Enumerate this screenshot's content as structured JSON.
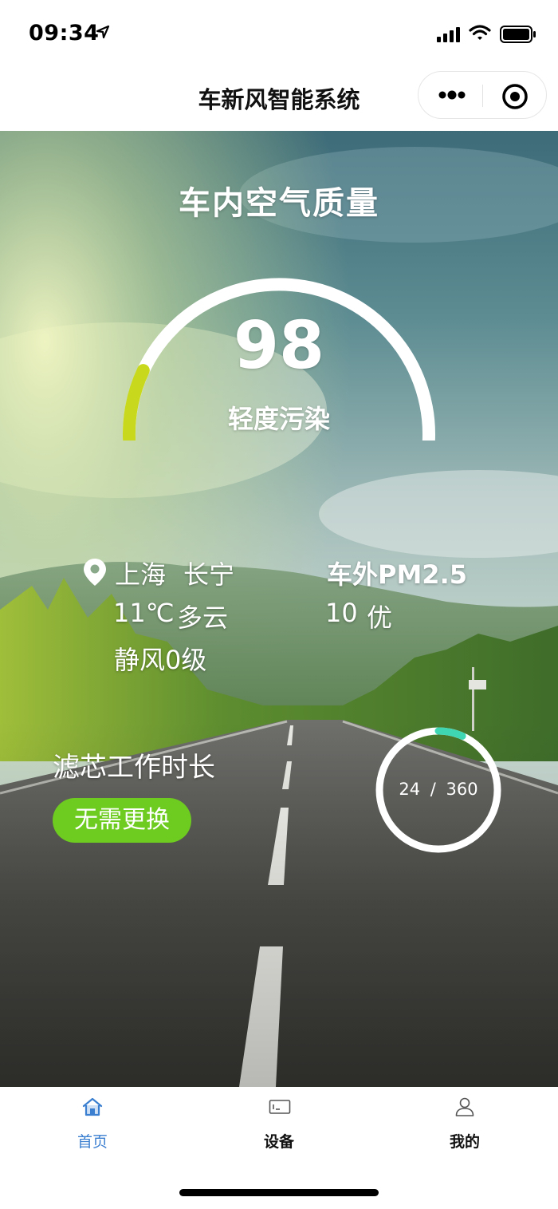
{
  "status_bar": {
    "time": "09:34"
  },
  "nav": {
    "title": "车新风智能系统"
  },
  "air_quality": {
    "title": "车内空气质量",
    "value": "98",
    "level": "轻度污染",
    "gauge_fraction": 0.16,
    "gauge_color": "#c8d91d"
  },
  "weather": {
    "city": "上海",
    "district": "长宁",
    "temperature": "11℃",
    "condition": "多云",
    "wind": "静风0级"
  },
  "outdoor": {
    "label": "车外PM2.5",
    "value": "10",
    "grade": "优"
  },
  "filter": {
    "label": "滤芯工作时长",
    "status": "无需更换",
    "status_color": "#6ecb1f",
    "used": "24",
    "total": "360",
    "separator": "/",
    "progress_color": "#3fd6b4"
  },
  "tabs": [
    {
      "label": "首页",
      "icon": "home-icon",
      "active": true
    },
    {
      "label": "设备",
      "icon": "device-icon",
      "active": false
    },
    {
      "label": "我的",
      "icon": "profile-icon",
      "active": false
    }
  ],
  "colors": {
    "accent": "#3b7fd0"
  }
}
